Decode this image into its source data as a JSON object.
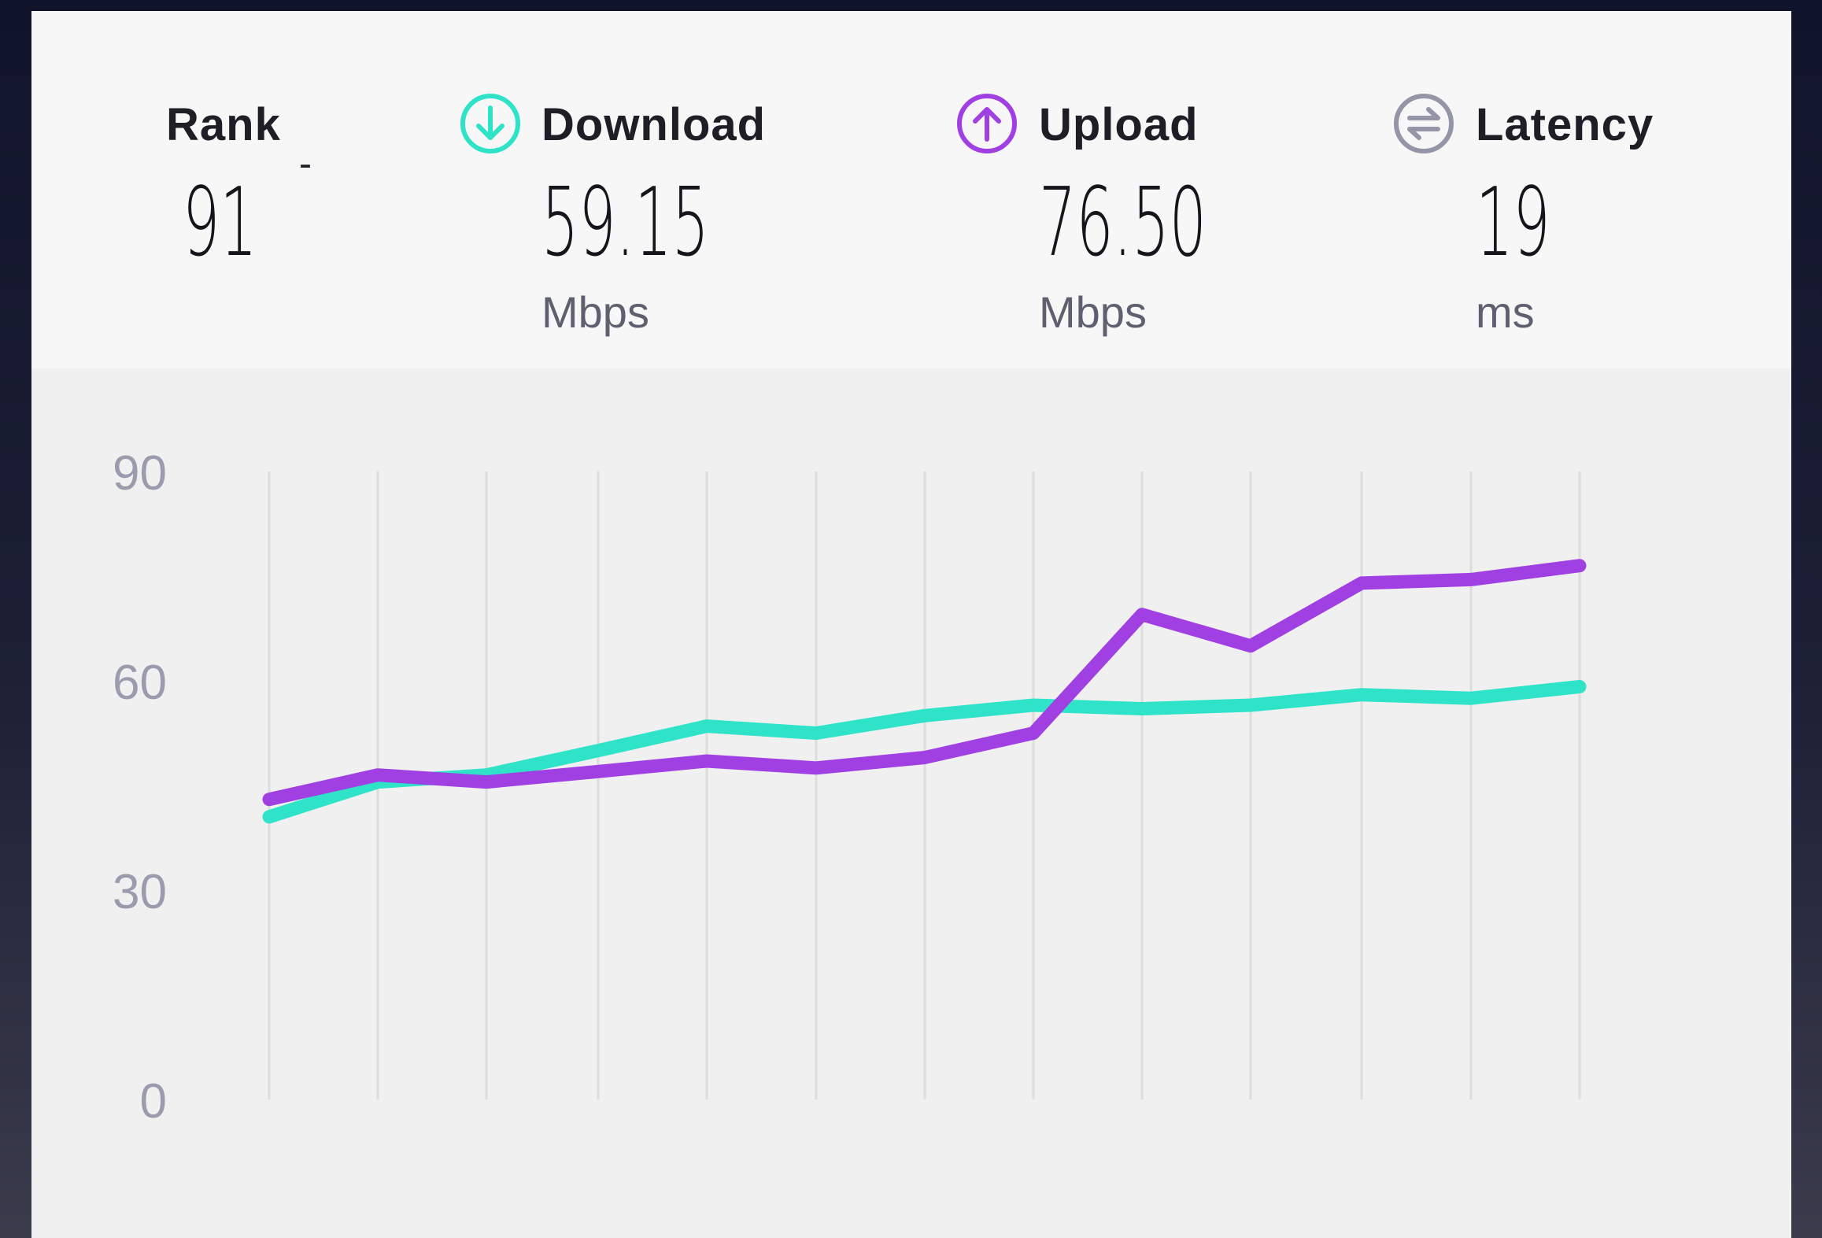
{
  "stats": {
    "rank": {
      "label": "Rank",
      "value": "91",
      "change": "-"
    },
    "download": {
      "label": "Download",
      "value": "59.15",
      "unit": "Mbps",
      "icon": "download-icon",
      "color": "#2ee3c8"
    },
    "upload": {
      "label": "Upload",
      "value": "76.50",
      "unit": "Mbps",
      "icon": "upload-icon",
      "color": "#a040e2"
    },
    "latency": {
      "label": "Latency",
      "value": "19",
      "unit": "ms",
      "icon": "latency-icon",
      "color": "#9496a8"
    }
  },
  "chart_data": {
    "type": "line",
    "y_ticks": [
      "90",
      "60",
      "30",
      "0"
    ],
    "ylim": [
      0,
      90
    ],
    "grid": "vertical",
    "x": [
      1,
      2,
      3,
      4,
      5,
      6,
      7,
      8,
      9,
      10,
      11,
      12,
      13
    ],
    "series": [
      {
        "color": "#2ee3c8",
        "values": [
          40.5,
          45.5,
          46.5,
          50,
          53.5,
          52.5,
          55,
          56.5,
          56,
          56.5,
          58,
          57.5,
          59.15
        ]
      },
      {
        "color": "#a040e2",
        "values": [
          43,
          46.5,
          45.5,
          47,
          48.5,
          47.5,
          49,
          52.5,
          69.5,
          65,
          74,
          74.5,
          76.5
        ]
      }
    ]
  }
}
